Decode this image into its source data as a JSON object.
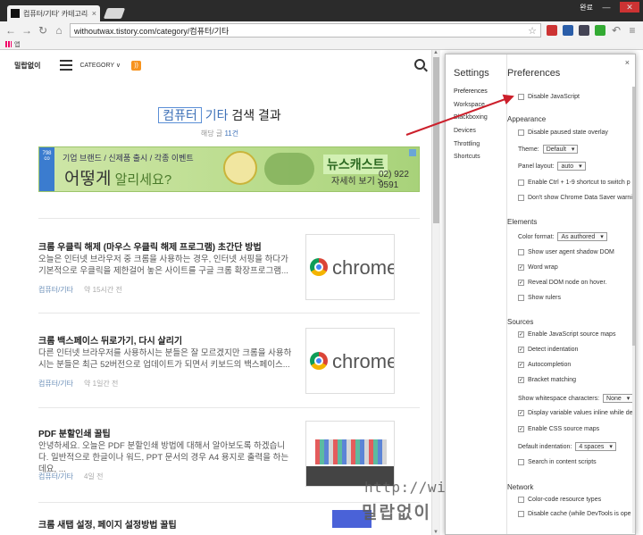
{
  "browser": {
    "tab_title": "컴퓨터/기타' 카테고리의",
    "tab_close": "×",
    "window_buttons": [
      "완료",
      "—",
      "✕"
    ],
    "url": "withoutwax.tistory.com/category/컴퓨터/기타",
    "bookmarks_label": "앱"
  },
  "site": {
    "brand": "밀랍없이",
    "category_menu": "CATEGORY ∨",
    "rss": "RSS",
    "heading_keyword": "컴퓨터",
    "heading_sub": "기타",
    "heading_rest": "검색 결과",
    "count_prefix": "해당 글",
    "count_value": "11건"
  },
  "banner": {
    "badge": "798 co",
    "line1": "기업 브랜드 / 신제품 출시 / 각종 이벤트",
    "line2_main": "어떻게",
    "line2_small": " 알리세요?",
    "news_title": "뉴스캐스트",
    "news_sub": "자세히 보기 >",
    "tel": "02) 922 9591"
  },
  "posts": [
    {
      "title": "크롬 우클릭 해제 (마우스 우클릭 해제 프로그램) 초간단 방법",
      "excerpt": "오늘은 인터넷 브라우저 중 크롬을 사용하는 경우, 인터넷 서핑을 하다가 기본적으로 우클릭을 제한걸어 놓은 사이트를 구글 크롬 확장프로그램...",
      "category": "컴퓨터/기타",
      "time": "약 15시간 전",
      "thumb_text": "chrome"
    },
    {
      "title": "크롬 백스페이스 뒤로가기, 다시 살리기",
      "excerpt": "다른 인터넷 브라우저를 사용하시는 분들은 잘 모르겠지만 크롬을 사용하시는 분들은 최근 52버전으로 업데이트가 되면서 키보드의 백스페이스...",
      "category": "컴퓨터/기타",
      "time": "약 1일간 전",
      "thumb_text": "chrome"
    },
    {
      "title": "PDF 분할인쇄 꿀팁",
      "excerpt": "안녕하세요. 오늘은 PDF 분할인쇄 방법에 대해서 알아보도록 하겠습니다. 일반적으로 한글이나 워드, PPT 문서의 경우 A4 용지로 출력을 하는데요, ...",
      "category": "컴퓨터/기타",
      "time": "4일 전",
      "thumb_text": ""
    },
    {
      "title": "크롬 새탭 설정, 페이지 설정방법 꿀팁",
      "excerpt": "",
      "category": "",
      "time": "",
      "thumb_text": ""
    }
  ],
  "watermark": {
    "url": "http://withoutwax.tistory.com",
    "name": "밀랍없이"
  },
  "devtools": {
    "close": "×",
    "settings_title": "Settings",
    "preferences_title": "Preferences",
    "side_items": [
      "Preferences",
      "Workspace",
      "Blackboxing",
      "Devices",
      "Throttling",
      "Shortcuts"
    ],
    "rows": [
      {
        "label": "Disable JavaScript",
        "checked": false
      },
      {
        "section": "Appearance"
      },
      {
        "label": "Disable paused state overlay",
        "checked": false
      },
      {
        "label": "Theme:",
        "select": "Default"
      },
      {
        "label": "Panel layout:",
        "select": "auto"
      },
      {
        "label": "Enable Ctrl + 1-9 shortcut to switch p",
        "checked": false
      },
      {
        "label": "Don't show Chrome Data Saver warni",
        "checked": false
      },
      {
        "section": "Elements"
      },
      {
        "label": "Color format:",
        "select": "As authored"
      },
      {
        "label": "Show user agent shadow DOM",
        "checked": false
      },
      {
        "label": "Word wrap",
        "checked": true
      },
      {
        "label": "Reveal DOM node on hover.",
        "checked": true
      },
      {
        "label": "Show rulers",
        "checked": false
      },
      {
        "section": "Sources"
      },
      {
        "label": "Enable JavaScript source maps",
        "checked": true
      },
      {
        "label": "Detect indentation",
        "checked": true
      },
      {
        "label": "Autocompletion",
        "checked": true
      },
      {
        "label": "Bracket matching",
        "checked": true
      },
      {
        "label": "Show whitespace characters:",
        "select": "None"
      },
      {
        "label": "Display variable values inline while de",
        "checked": true
      },
      {
        "label": "Enable CSS source maps",
        "checked": true
      },
      {
        "label": "Default indentation:",
        "select": "4 spaces"
      },
      {
        "label": "Search in content scripts",
        "checked": false
      },
      {
        "section": "Network"
      },
      {
        "label": "Color-code resource types",
        "checked": false
      },
      {
        "label": "Disable cache (while DevTools is ope",
        "checked": false
      }
    ]
  },
  "colors": {
    "accent": "#3f72b8",
    "arrow": "#cc1f2b",
    "chrome_dark": "#2b2b2b"
  }
}
